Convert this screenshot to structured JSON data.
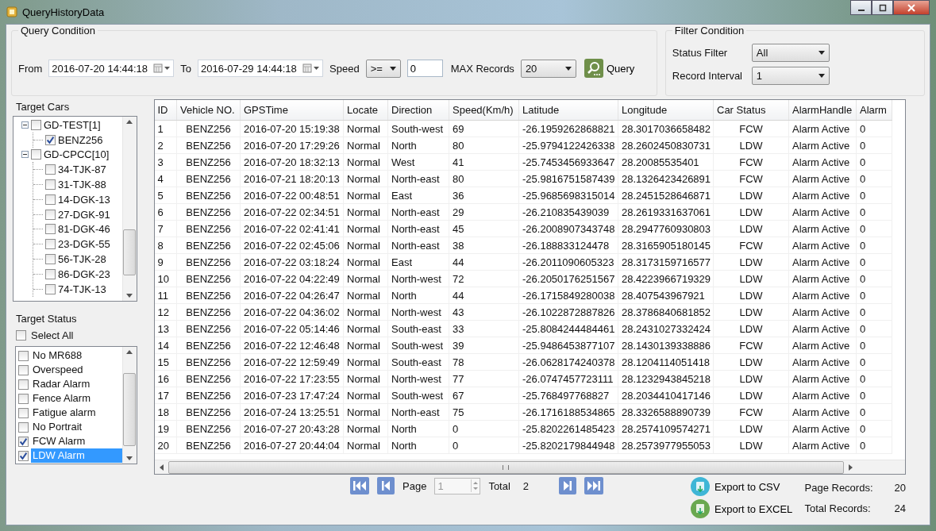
{
  "window": {
    "title": "QueryHistoryData"
  },
  "query": {
    "title": "Query Condition",
    "from_label": "From",
    "from": "2016-07-20 14:44:18",
    "to_label": "To",
    "to": "2016-07-29 14:44:18",
    "speed_label": "Speed",
    "speed_operator": ">=",
    "speed_value": "0",
    "max_records_label": "MAX Records",
    "max_records": "20",
    "query_button": "Query"
  },
  "filter": {
    "title": "Filter Condition",
    "status_filter_label": "Status Filter",
    "status_filter": "All",
    "record_interval_label": "Record Interval",
    "record_interval": "1"
  },
  "target_cars": {
    "title": "Target Cars",
    "tree": [
      {
        "label": "GD-TEST[1]",
        "checked": false,
        "expanded": true,
        "children": [
          {
            "label": "BENZ256",
            "checked": true
          }
        ]
      },
      {
        "label": "GD-CPCC[10]",
        "checked": false,
        "expanded": true,
        "children": [
          {
            "label": "34-TJK-87",
            "checked": false
          },
          {
            "label": "31-TJK-88",
            "checked": false
          },
          {
            "label": "14-DGK-13",
            "checked": false
          },
          {
            "label": "27-DGK-91",
            "checked": false
          },
          {
            "label": "81-DGK-46",
            "checked": false
          },
          {
            "label": "23-DGK-55",
            "checked": false
          },
          {
            "label": "56-TJK-28",
            "checked": false
          },
          {
            "label": "86-DGK-23",
            "checked": false
          },
          {
            "label": "74-TJK-13",
            "checked": false
          }
        ]
      }
    ]
  },
  "target_status": {
    "title": "Target Status",
    "select_all": {
      "label": "Select All",
      "checked": false
    },
    "items": [
      {
        "label": "No MR688",
        "checked": false,
        "selected": false
      },
      {
        "label": "Overspeed",
        "checked": false,
        "selected": false
      },
      {
        "label": "Radar Alarm",
        "checked": false,
        "selected": false
      },
      {
        "label": "Fence Alarm",
        "checked": false,
        "selected": false
      },
      {
        "label": "Fatigue alarm",
        "checked": false,
        "selected": false
      },
      {
        "label": "No Portrait",
        "checked": false,
        "selected": false
      },
      {
        "label": "FCW Alarm",
        "checked": true,
        "selected": false
      },
      {
        "label": "LDW Alarm",
        "checked": true,
        "selected": true
      }
    ]
  },
  "table": {
    "columns": [
      "ID",
      "Vehicle NO.",
      "GPSTime",
      "Locate",
      "Direction",
      "Speed(Km/h)",
      "Latitude",
      "Longitude",
      "Car Status",
      "AlarmHandle",
      "Alarm"
    ],
    "rows": [
      [
        "1",
        "BENZ256",
        "2016-07-20 15:19:38",
        "Normal",
        "South-west",
        "69",
        "-26.1959262868821",
        "28.3017036658482",
        "FCW",
        "Alarm Active",
        "0"
      ],
      [
        "2",
        "BENZ256",
        "2016-07-20 17:29:26",
        "Normal",
        "North",
        "80",
        "-25.9794122426338",
        "28.2602450830731",
        "LDW",
        "Alarm Active",
        "0"
      ],
      [
        "3",
        "BENZ256",
        "2016-07-20 18:32:13",
        "Normal",
        "West",
        "41",
        "-25.7453456933647",
        "28.20085535401",
        "FCW",
        "Alarm Active",
        "0"
      ],
      [
        "4",
        "BENZ256",
        "2016-07-21 18:20:13",
        "Normal",
        "North-east",
        "80",
        "-25.9816751587439",
        "28.1326423426891",
        "FCW",
        "Alarm Active",
        "0"
      ],
      [
        "5",
        "BENZ256",
        "2016-07-22 00:48:51",
        "Normal",
        "East",
        "36",
        "-25.9685698315014",
        "28.2451528646871",
        "LDW",
        "Alarm Active",
        "0"
      ],
      [
        "6",
        "BENZ256",
        "2016-07-22 02:34:51",
        "Normal",
        "North-east",
        "29",
        "-26.210835439039",
        "28.2619331637061",
        "LDW",
        "Alarm Active",
        "0"
      ],
      [
        "7",
        "BENZ256",
        "2016-07-22 02:41:41",
        "Normal",
        "North-east",
        "45",
        "-26.2008907343748",
        "28.2947760930803",
        "LDW",
        "Alarm Active",
        "0"
      ],
      [
        "8",
        "BENZ256",
        "2016-07-22 02:45:06",
        "Normal",
        "North-east",
        "38",
        "-26.188833124478",
        "28.3165905180145",
        "FCW",
        "Alarm Active",
        "0"
      ],
      [
        "9",
        "BENZ256",
        "2016-07-22 03:18:24",
        "Normal",
        "East",
        "44",
        "-26.2011090605323",
        "28.3173159716577",
        "LDW",
        "Alarm Active",
        "0"
      ],
      [
        "10",
        "BENZ256",
        "2016-07-22 04:22:49",
        "Normal",
        "North-west",
        "72",
        "-26.2050176251567",
        "28.4223966719329",
        "LDW",
        "Alarm Active",
        "0"
      ],
      [
        "11",
        "BENZ256",
        "2016-07-22 04:26:47",
        "Normal",
        "North",
        "44",
        "-26.1715849280038",
        "28.407543967921",
        "LDW",
        "Alarm Active",
        "0"
      ],
      [
        "12",
        "BENZ256",
        "2016-07-22 04:36:02",
        "Normal",
        "North-west",
        "43",
        "-26.1022872887826",
        "28.3786840681852",
        "LDW",
        "Alarm Active",
        "0"
      ],
      [
        "13",
        "BENZ256",
        "2016-07-22 05:14:46",
        "Normal",
        "South-east",
        "33",
        "-25.8084244484461",
        "28.2431027332424",
        "LDW",
        "Alarm Active",
        "0"
      ],
      [
        "14",
        "BENZ256",
        "2016-07-22 12:46:48",
        "Normal",
        "South-west",
        "39",
        "-25.9486453877107",
        "28.1430139338886",
        "FCW",
        "Alarm Active",
        "0"
      ],
      [
        "15",
        "BENZ256",
        "2016-07-22 12:59:49",
        "Normal",
        "South-east",
        "78",
        "-26.0628174240378",
        "28.1204114051418",
        "LDW",
        "Alarm Active",
        "0"
      ],
      [
        "16",
        "BENZ256",
        "2016-07-22 17:23:55",
        "Normal",
        "North-west",
        "77",
        "-26.0747457723111",
        "28.1232943845218",
        "LDW",
        "Alarm Active",
        "0"
      ],
      [
        "17",
        "BENZ256",
        "2016-07-23 17:47:24",
        "Normal",
        "South-west",
        "67",
        "-25.768497768827",
        "28.2034410417146",
        "LDW",
        "Alarm Active",
        "0"
      ],
      [
        "18",
        "BENZ256",
        "2016-07-24 13:25:51",
        "Normal",
        "North-east",
        "75",
        "-26.1716188534865",
        "28.3326588890739",
        "FCW",
        "Alarm Active",
        "0"
      ],
      [
        "19",
        "BENZ256",
        "2016-07-27 20:43:28",
        "Normal",
        "North",
        "0",
        "-25.8202261485423",
        "28.2574109574271",
        "LDW",
        "Alarm Active",
        "0"
      ],
      [
        "20",
        "BENZ256",
        "2016-07-27 20:44:04",
        "Normal",
        "North",
        "0",
        "-25.8202179844948",
        "28.2573977955053",
        "LDW",
        "Alarm Active",
        "0"
      ]
    ]
  },
  "pager": {
    "page_label": "Page",
    "page": "1",
    "total_label": "Total",
    "total": "2"
  },
  "exports": [
    {
      "kind": "csv",
      "label": "Export to CSV"
    },
    {
      "kind": "excel",
      "label": "Export to EXCEL"
    }
  ],
  "records": [
    {
      "label": "Page Records:",
      "value": "20"
    },
    {
      "label": "Total Records:",
      "value": "24"
    }
  ]
}
